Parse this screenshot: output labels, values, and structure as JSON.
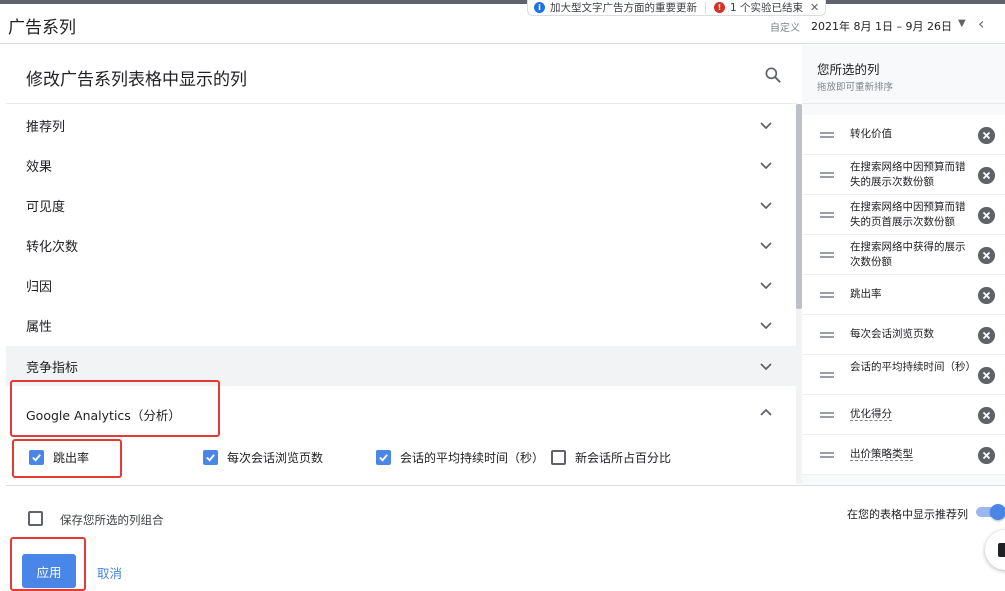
{
  "header": {
    "title": "广告系列",
    "notice_text": "加大型文字广告方面的重要更新",
    "experiment_text": "1 个实验已结束",
    "date_label": "自定义",
    "date_range": "2021年 8月 1日 – 9月 26日"
  },
  "panel": {
    "title": "修改广告系列表格中显示的列",
    "categories": [
      {
        "label": "推荐列"
      },
      {
        "label": "效果"
      },
      {
        "label": "可见度"
      },
      {
        "label": "转化次数"
      },
      {
        "label": "归因"
      },
      {
        "label": "属性"
      },
      {
        "label": "竞争指标"
      }
    ],
    "expanded_category": "Google Analytics（分析）",
    "options": [
      {
        "label": "跳出率",
        "checked": true
      },
      {
        "label": "每次会话浏览页数",
        "checked": true
      },
      {
        "label": "会话的平均持续时间（秒）",
        "checked": true
      },
      {
        "label": "新会话所占百分比",
        "checked": false
      }
    ]
  },
  "selected": {
    "title": "您所选的列",
    "subtitle": "拖放即可重新排序",
    "items": [
      {
        "label": "转化价值"
      },
      {
        "label": "在搜索网络中因预算而错失的展示次数份额"
      },
      {
        "label": "在搜索网络中因预算而错失的页首展示次数份额"
      },
      {
        "label": "在搜索网络中获得的展示次数份额"
      },
      {
        "label": "跳出率"
      },
      {
        "label": "每次会话浏览页数"
      },
      {
        "label": "会话的平均持续时间（秒）"
      },
      {
        "label": "优化得分"
      },
      {
        "label": "出价策略类型"
      }
    ]
  },
  "footer": {
    "save_label": "保存您所选的列组合",
    "save_checked": false,
    "show_recommended_label": "在您的表格中显示推荐列",
    "show_recommended_on": true,
    "apply_label": "应用",
    "cancel_label": "取消"
  },
  "colors": {
    "accent": "#4a86e8",
    "highlight": "#e53935"
  }
}
